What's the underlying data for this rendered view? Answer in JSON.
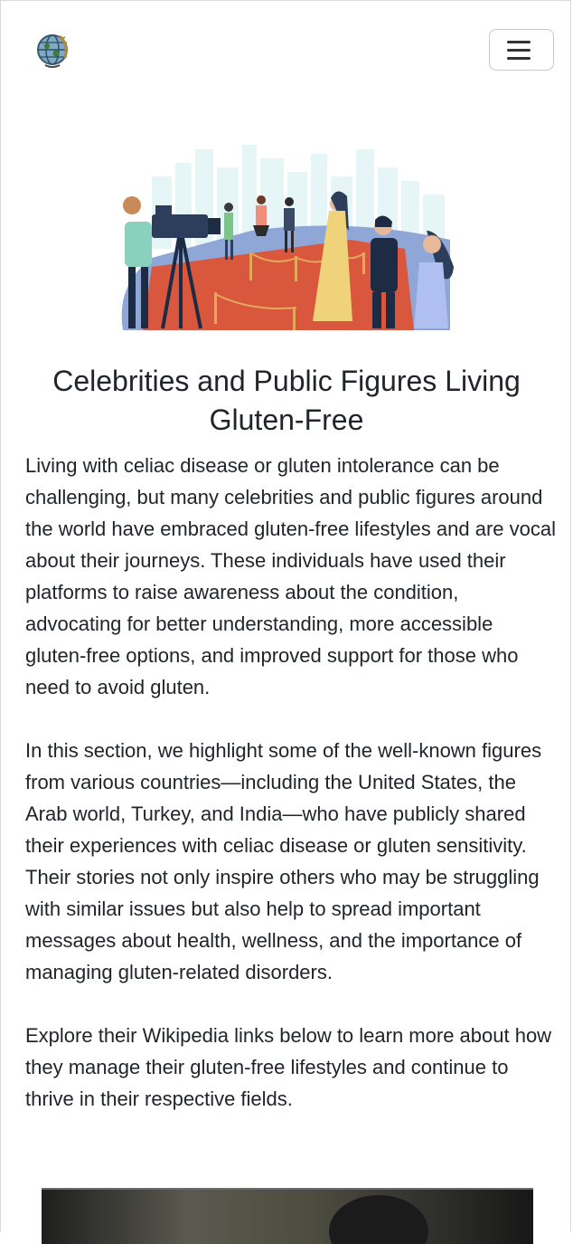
{
  "navbar": {
    "logo_icon": "globe-wheat-logo",
    "menu_icon": "hamburger-menu-icon"
  },
  "hero": {
    "image_icon": "red-carpet-celebrities-illustration"
  },
  "page": {
    "title": "Celebrities and Public Figures Living Gluten-Free",
    "paragraphs": [
      "Living with celiac disease or gluten intolerance can be challenging, but many celebrities and public figures around the world have embraced gluten-free lifestyles and are vocal about their journeys. These individuals have used their platforms to raise awareness about the condition, advocating for better understanding, more accessible gluten-free options, and improved support for those who need to avoid gluten.",
      "In this section, we highlight some of the well-known figures from various countries—including the United States, the Arab world, Turkey, and India—who have publicly shared their experiences with celiac disease or gluten sensitivity. Their stories not only inspire others who may be struggling with similar issues but also help to spread important messages about health, wellness, and the importance of managing gluten-related disorders.",
      "Explore their Wikipedia links below to learn more about how they manage their gluten-free lifestyles and continue to thrive in their respective fields."
    ]
  },
  "colors": {
    "text": "#212529",
    "toggler_border": "#c8c8c8"
  }
}
